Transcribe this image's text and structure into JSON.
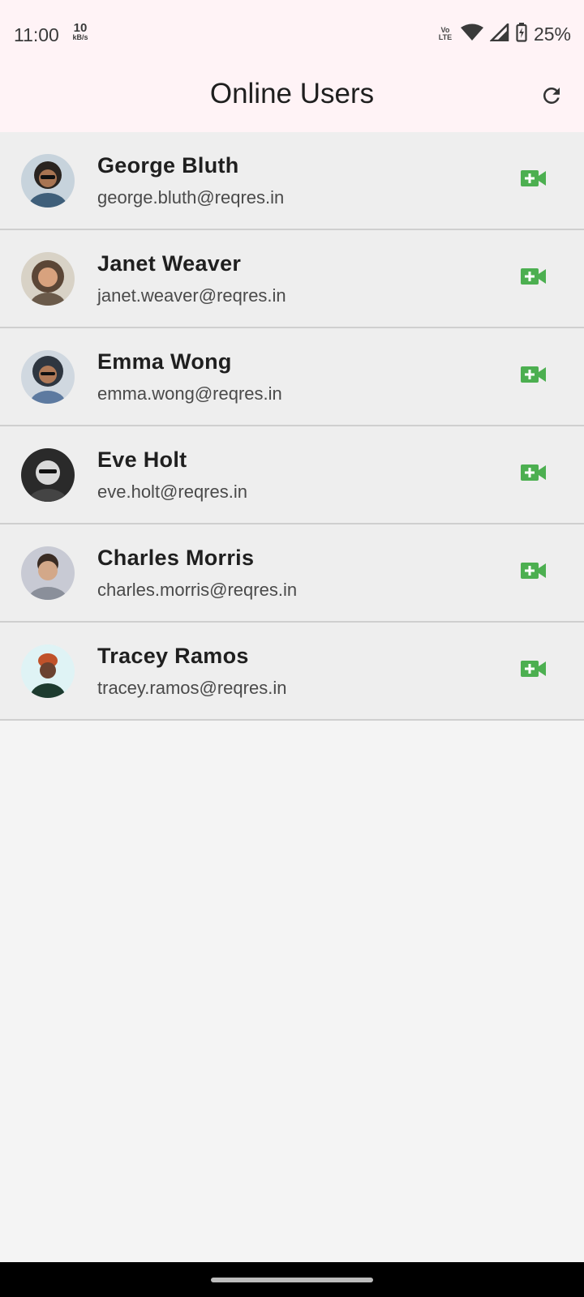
{
  "status_bar": {
    "time": "11:00",
    "net_speed_value": "10",
    "net_speed_unit": "kB/s",
    "volte_top": "Vo",
    "volte_bottom": "LTE",
    "battery": "25%"
  },
  "app_bar": {
    "title": "Online Users",
    "refresh_icon": "refresh-icon"
  },
  "users": [
    {
      "name": "George Bluth",
      "email": "george.bluth@reqres.in",
      "avatar_color": "#3f5f7a"
    },
    {
      "name": "Janet Weaver",
      "email": "janet.weaver@reqres.in",
      "avatar_color": "#5b4636"
    },
    {
      "name": "Emma Wong",
      "email": "emma.wong@reqres.in",
      "avatar_color": "#2e3640"
    },
    {
      "name": "Eve Holt",
      "email": "eve.holt@reqres.in",
      "avatar_color": "#444444"
    },
    {
      "name": "Charles Morris",
      "email": "charles.morris@reqres.in",
      "avatar_color": "#8a8f9a"
    },
    {
      "name": "Tracey Ramos",
      "email": "tracey.ramos@reqres.in",
      "avatar_color": "#1d3b2f"
    }
  ],
  "colors": {
    "accent_green": "#4caf50",
    "app_bar_bg": "#fff3f6",
    "row_bg": "#eeeeee",
    "page_bg": "#f4f4f4"
  },
  "icons": {
    "call": "video-call-add-icon",
    "refresh": "refresh-icon"
  }
}
